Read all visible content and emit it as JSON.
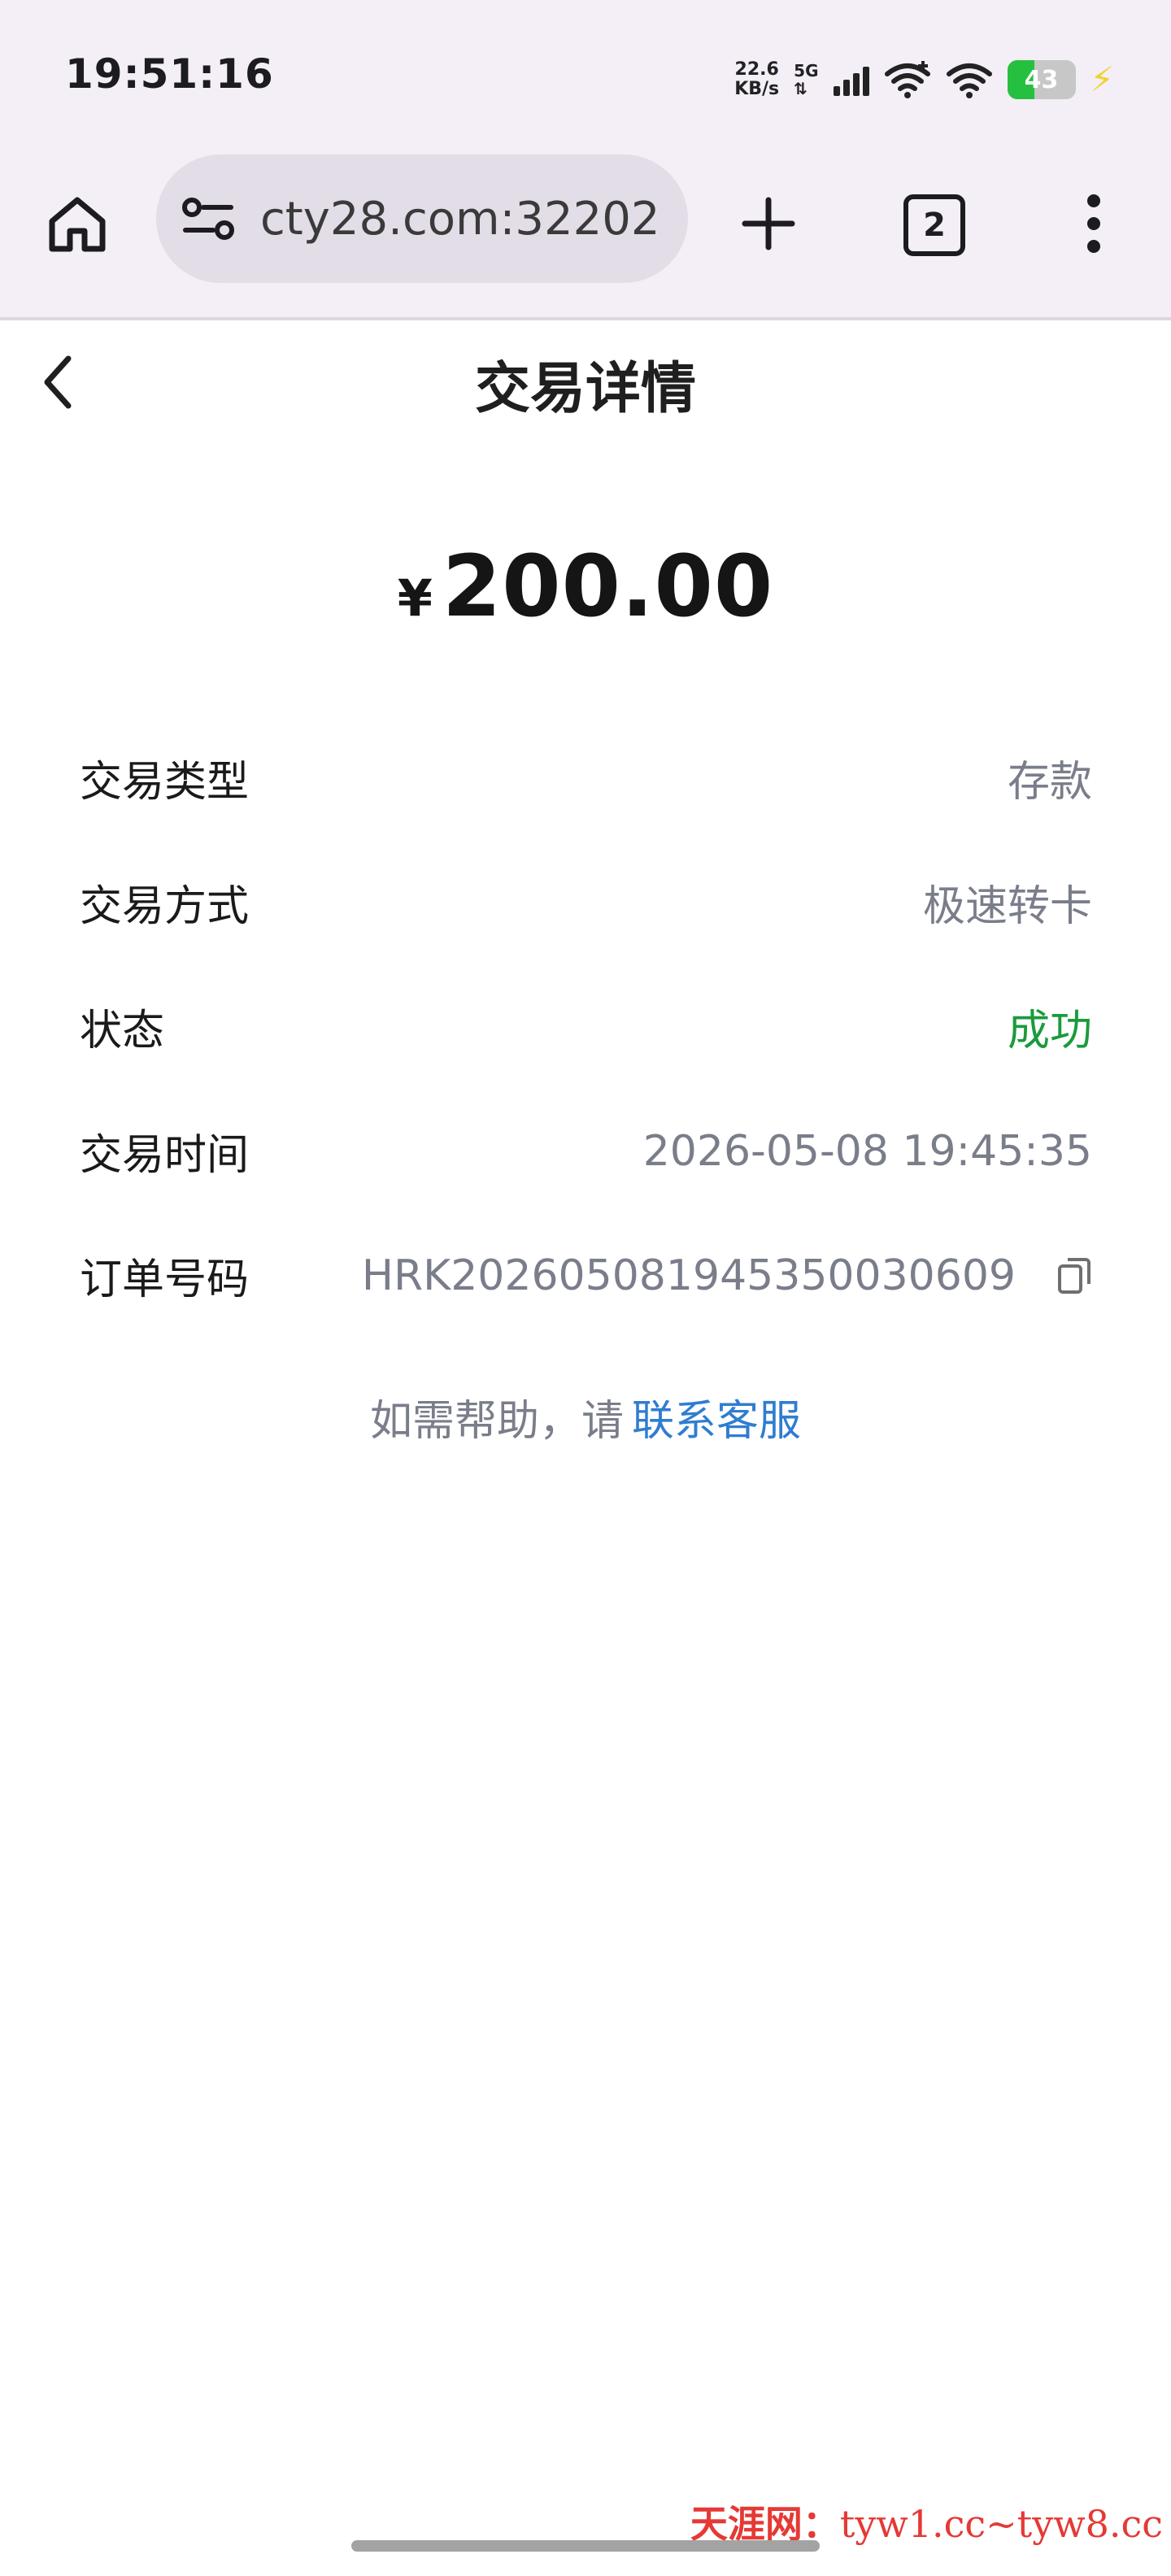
{
  "status_bar": {
    "time": "19:51:16",
    "net_speed_value": "22.6",
    "net_speed_unit": "KB/s",
    "network_type": "5G",
    "battery_level": "43",
    "colors": {
      "battery_fill": "#26c041",
      "charging": "#f0d22c"
    }
  },
  "browser": {
    "url": "cty28.com:32202",
    "tab_count": "2",
    "icons": [
      "home-icon",
      "site-settings-icon",
      "new-tab-icon",
      "tab-switcher-icon",
      "more-menu-icon"
    ]
  },
  "page": {
    "title": "交易详情",
    "back_icon": "chevron-left-icon"
  },
  "transaction": {
    "currency_symbol": "¥",
    "amount": "200.00",
    "rows": [
      {
        "label": "交易类型",
        "value": "存款"
      },
      {
        "label": "交易方式",
        "value": "极速转卡"
      },
      {
        "label": "状态",
        "value": "成功"
      },
      {
        "label": "交易时间",
        "value": "2026-05-08 19:45:35"
      },
      {
        "label": "订单号码",
        "value": "HRK20260508194535003​0609",
        "value_clean": "HRK202605081945350030609"
      }
    ],
    "status_color": "#1a9b3c"
  },
  "help": {
    "prefix": "如需帮助，请",
    "link": "联系客服",
    "link_color": "#2f7dd1"
  },
  "watermark": {
    "name": "天涯网：",
    "urls": "tyw1.cc~tyw8.cc"
  }
}
